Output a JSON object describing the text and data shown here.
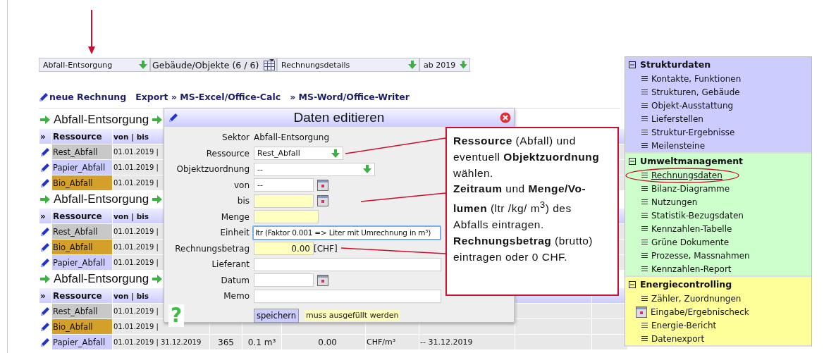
{
  "toolbar": [
    {
      "kind": "select",
      "value": "Abfall-Entsorgung"
    },
    {
      "kind": "filter",
      "label": "Gebäude/Objekte (6 / 6)"
    },
    {
      "kind": "select",
      "value": "Rechnungsdetails"
    },
    {
      "kind": "select",
      "value": "ab 2019"
    }
  ],
  "links": [
    {
      "kind": "new",
      "label": "neue Rechnung"
    },
    {
      "kind": "plain",
      "label": "Export » MS-Excel/Office-Calc"
    },
    {
      "kind": "plain",
      "label": "» MS-Word/Office-Writer"
    }
  ],
  "groups": [
    {
      "title": "Abfall-Entsorgung",
      "header": {
        "marker": "»",
        "resource": "Ressource",
        "period": "von | bis"
      },
      "rows": [
        {
          "resource": "Rest_Abfall",
          "color": "#c8c8c8",
          "period": "01.01.2019 |"
        },
        {
          "resource": "Papier_Abfall",
          "color": "#ccccff",
          "period": "01.01.2019 |"
        },
        {
          "resource": "Bio_Abfall",
          "color": "#d4a02a",
          "period": "01.01.2019 |"
        }
      ]
    },
    {
      "title": "Abfall-Entsorgung",
      "header": {
        "marker": "»",
        "resource": "Ressource",
        "period": "von | bis"
      },
      "rows": [
        {
          "resource": "Rest_Abfall",
          "color": "#c8c8c8",
          "period": "01.01.2019 |"
        },
        {
          "resource": "Bio_Abfall",
          "color": "#d4a02a",
          "period": "01.01.2019 |"
        },
        {
          "resource": "Papier_Abfall",
          "color": "#ccccff",
          "period": "01.01.2019 |"
        }
      ]
    },
    {
      "title": "Abfall-Entsorgung",
      "header": {
        "marker": "»",
        "resource": "Ressource",
        "period": "von | bis"
      },
      "rows": [
        {
          "resource": "Rest_Abfall",
          "color": "#c8c8c8",
          "period": "01.01.2019 |"
        },
        {
          "resource": "Bio_Abfall",
          "color": "#d4a02a",
          "period": "01.01.2019 |"
        },
        {
          "resource": "Papier_Abfall",
          "color": "#ccccff",
          "period": "01.01.2019 | 31.12.2019",
          "days": "365",
          "quantity": "0.1 m³",
          "amount": "0.00",
          "unit": "CHF/m³",
          "date": "-- 31.12.2019"
        }
      ]
    }
  ],
  "dialog": {
    "title": "Daten editieren",
    "fields": [
      {
        "label": "Sektor",
        "kind": "static",
        "value": "Abfall-Entsorgung",
        "required": false
      },
      {
        "label": "Ressource",
        "kind": "select",
        "value": "Rest_Abfall",
        "required": false
      },
      {
        "label": "Objektzuordnung",
        "kind": "long-select",
        "value": "--",
        "required": false
      },
      {
        "label": "von",
        "kind": "date",
        "value": "--",
        "required": false
      },
      {
        "label": "bis",
        "kind": "date",
        "required": true
      },
      {
        "label": "Menge",
        "kind": "input",
        "required": true
      },
      {
        "label": "Einheit",
        "kind": "unit",
        "value": "ltr (Faktor 0.001 => Liter mit Umrechnung in m³)",
        "required": false
      },
      {
        "label": "Rechnungsbetrag",
        "kind": "amount",
        "value": "0.00",
        "suffix": "[CHF]",
        "required": true
      },
      {
        "label": "Lieferant",
        "kind": "line",
        "required": false
      },
      {
        "label": "Datum",
        "kind": "date",
        "required": false
      },
      {
        "label": "Memo",
        "kind": "line",
        "required": false
      }
    ],
    "help": "?",
    "button": "speichern",
    "note": "muss ausgefüllt werden"
  },
  "callout": {
    "paragraphs": [
      "**Ressource** (Abfall) und eventuell **Objektzuordnung** wählen.",
      "**Zeitraum** und **Menge/Vo-lumen** (ltr /kg/ m$^{3}$) des Abfalls eintragen.",
      "**Rechnungsbetrag** (brutto) eintragen oder 0 CHF."
    ]
  },
  "sidebar": {
    "sections": [
      {
        "title": "Strukturdaten",
        "color": "#ccccff",
        "expanded": true,
        "items": [
          {
            "label": "Kontakte, Funktionen",
            "kind": "menu",
            "selected": false
          },
          {
            "label": "Strukturen, Gebäude",
            "kind": "menu",
            "selected": false
          },
          {
            "label": "Objekt-Ausstattung",
            "kind": "menu",
            "selected": false
          },
          {
            "label": "Lieferstellen",
            "kind": "menu",
            "selected": false
          },
          {
            "label": "Struktur-Ergebnisse",
            "kind": "menu",
            "selected": false
          },
          {
            "label": "Meilensteine",
            "kind": "menu",
            "selected": false
          }
        ]
      },
      {
        "title": "Umweltmanagement",
        "color": "#ccffcc",
        "expanded": true,
        "items": [
          {
            "label": "Rechnungsdaten",
            "kind": "menu",
            "selected": true
          },
          {
            "label": "Bilanz-Diagramme",
            "kind": "menu",
            "selected": false
          },
          {
            "label": "Nutzungen",
            "kind": "menu",
            "selected": false
          },
          {
            "label": "Statistik-Bezugsdaten",
            "kind": "menu",
            "selected": false
          },
          {
            "label": "Kennzahlen-Tabelle",
            "kind": "menu",
            "selected": false
          },
          {
            "label": "Grüne Dokumente",
            "kind": "menu",
            "selected": false
          },
          {
            "label": "Prozesse, Massnahmen",
            "kind": "menu",
            "selected": false
          },
          {
            "label": "Kennzahlen-Report",
            "kind": "menu",
            "selected": false
          }
        ]
      },
      {
        "title": "Energiecontrolling",
        "color": "#ffff99",
        "expanded": true,
        "items": [
          {
            "label": "Zähler, Zuordnungen",
            "kind": "menu",
            "selected": false
          },
          {
            "label": "Eingabe/Ergebnischeck",
            "kind": "calendar",
            "selected": false
          },
          {
            "label": "Energie-Bericht",
            "kind": "menu",
            "selected": false
          },
          {
            "label": "Datenexport",
            "kind": "menu",
            "selected": false
          }
        ]
      }
    ]
  }
}
